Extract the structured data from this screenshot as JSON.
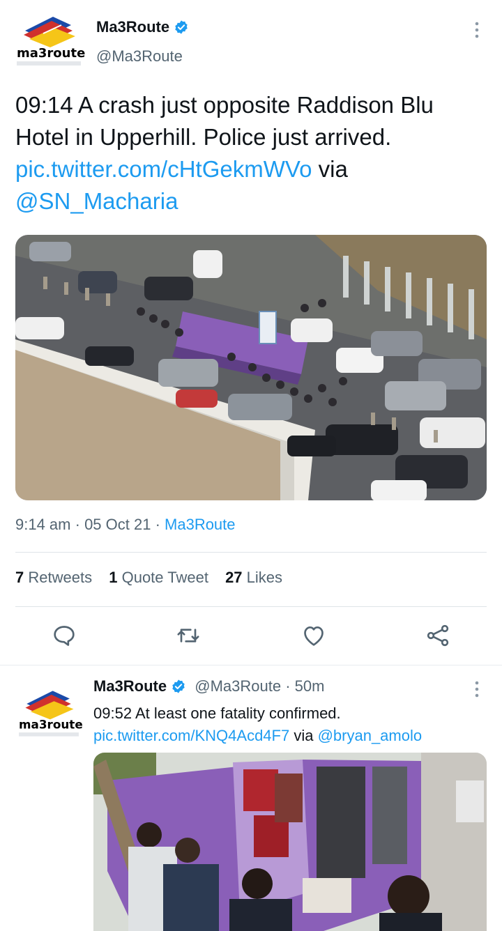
{
  "main_tweet": {
    "avatar": {
      "logo_text": "ma3route"
    },
    "display_name": "Ma3Route",
    "handle": "@Ma3Route",
    "text_before_link": "09:14 A crash just opposite Raddison Blu Hotel in Upperhill. Police just arrived. ",
    "link": "pic.twitter.com/cHtGekmWVo",
    "text_via": " via ",
    "mention": "@SN_Macharia",
    "image_description": "aerial view of traffic and crowd around overturned purple bus",
    "time": "9:14 am",
    "date": "05 Oct 21",
    "source": "Ma3Route",
    "meta_sep": " · ",
    "retweets_count": "7",
    "retweets_label": "Retweets",
    "quotes_count": "1",
    "quotes_label": "Quote Tweet",
    "likes_count": "27",
    "likes_label": "Likes",
    "actions": [
      "reply-icon",
      "retweet-icon",
      "like-icon",
      "share-icon"
    ]
  },
  "reply_tweet": {
    "avatar": {
      "logo_text": "ma3route"
    },
    "display_name": "Ma3Route",
    "handle": "@Ma3Route",
    "time_sep": " · ",
    "relative_time": "50m",
    "text": "09:52 At least one fatality confirmed.",
    "link": "pic.twitter.com/KNQ4Acd4F7",
    "text_via": " via ",
    "mention": "@bryan_amolo",
    "image_description": "close up of overturned purple bus with onlookers"
  },
  "colors": {
    "link": "#1d9bf0",
    "secondary_text": "#536471",
    "verified": "#1d9bf0",
    "bus_purple": "#8a5fb8"
  }
}
